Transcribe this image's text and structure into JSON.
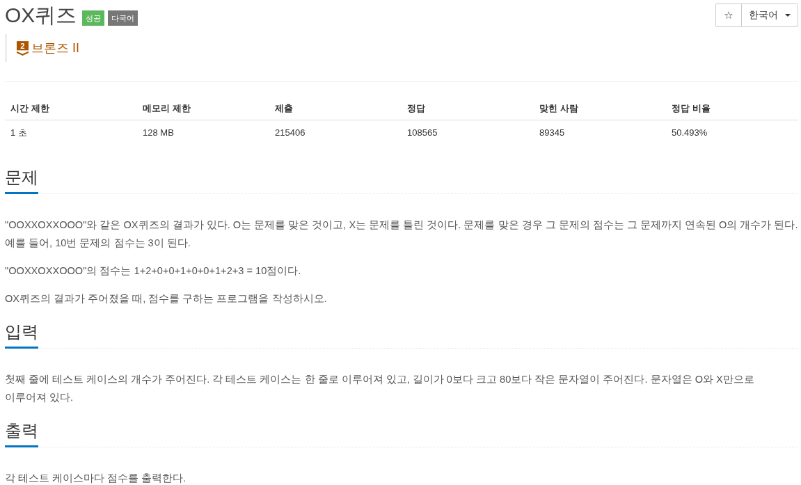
{
  "header": {
    "title": "OX퀴즈",
    "badges": [
      {
        "label": "성공",
        "kind": "success"
      },
      {
        "label": "다국어",
        "kind": "neutral"
      }
    ],
    "star_button": "☆",
    "language_select": {
      "value": "한국어"
    }
  },
  "tier": {
    "kind": "bronze",
    "number": "2",
    "label": "브론즈 II"
  },
  "stats": {
    "columns": [
      "시간 제한",
      "메모리 제한",
      "제출",
      "정답",
      "맞힌 사람",
      "정답 비율"
    ],
    "rows": [
      [
        "1 초",
        "128 MB",
        "215406",
        "108565",
        "89345",
        "50.493%"
      ]
    ]
  },
  "sections": [
    {
      "title": "문제",
      "paragraphs": [
        "\"OOXXOXXOOO\"와 같은 OX퀴즈의 결과가 있다. O는 문제를 맞은 것이고, X는 문제를 틀린 것이다. 문제를 맞은 경우 그 문제의 점수는 그 문제까지 연속된 O의 개수가 된다. 예를 들어, 10번 문제의 점수는 3이 된다.",
        "\"OOXXOXXOOO\"의 점수는 1+2+0+0+1+0+0+1+2+3 = 10점이다.",
        "OX퀴즈의 결과가 주어졌을 때, 점수를 구하는 프로그램을 작성하시오."
      ]
    },
    {
      "title": "입력",
      "paragraphs": [
        "첫째 줄에 테스트 케이스의 개수가 주어진다. 각 테스트 케이스는 한 줄로 이루어져 있고, 길이가 0보다 크고 80보다 작은 문자열이 주어진다. 문자열은 O와 X만으로 이루어져 있다."
      ]
    },
    {
      "title": "출력",
      "paragraphs": [
        "각 테스트 케이스마다 점수를 출력한다."
      ]
    }
  ]
}
